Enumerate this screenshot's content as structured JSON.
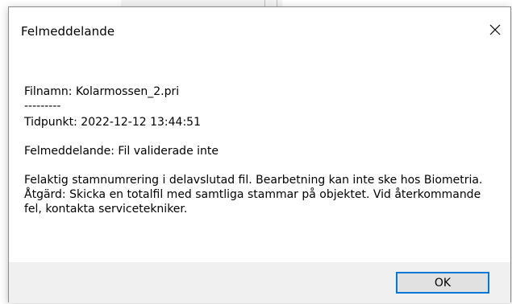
{
  "dialog": {
    "title": "Felmeddelande",
    "lines": {
      "filename": "Filnamn: Kolarmossen_2.pri",
      "separator": "---------",
      "timestamp": "Tidpunkt: 2022-12-12 13:44:51",
      "error": "Felmeddelande: Fil validerade inte",
      "details": "Felaktig stamnumrering i delavslutad fil. Bearbetning kan inte ske hos Biometria. Åtgärd: Skicka en totalfil med samtliga stammar på objektet. Vid återkommande fel, kontakta servicetekniker."
    },
    "ok_label": "OK"
  },
  "colors": {
    "accent": "#0078d7",
    "footer_bg": "#f0f0f0",
    "button_bg": "#e1e1e1"
  },
  "icons": {
    "close": "close-icon"
  }
}
